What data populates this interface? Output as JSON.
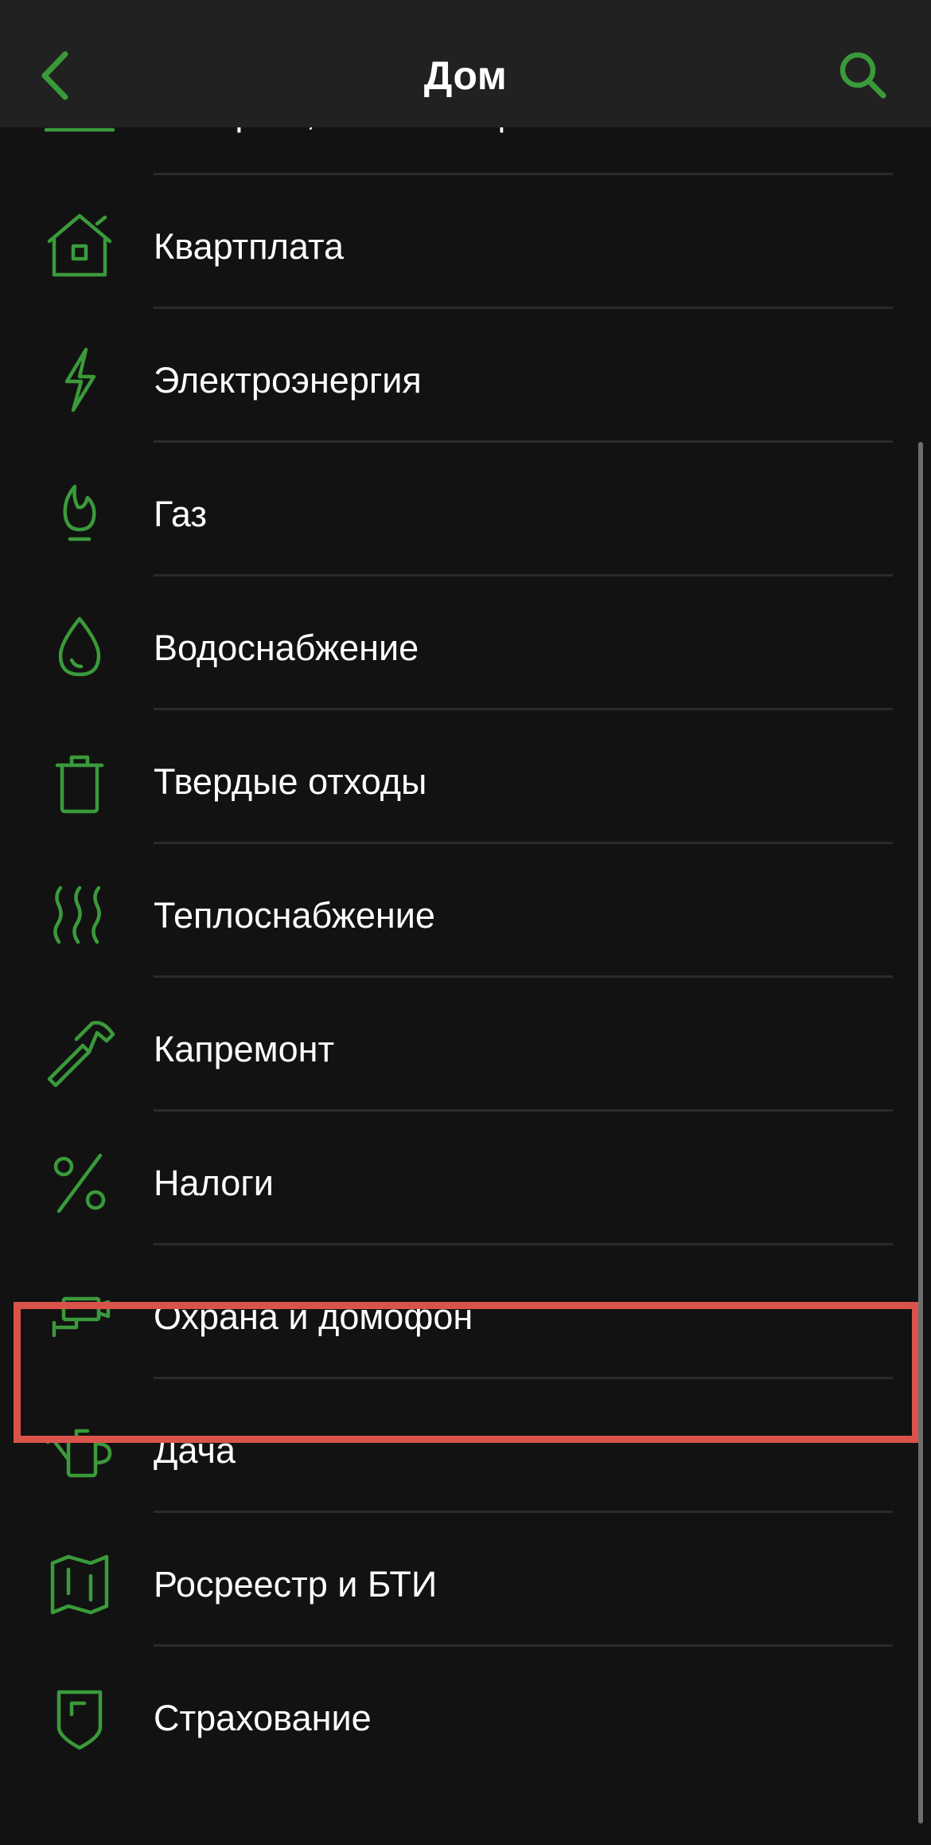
{
  "header": {
    "title": "Дом",
    "back_icon": "chevron-left-icon",
    "search_icon": "search-icon"
  },
  "colors": {
    "background": "#121212",
    "header_background": "#212121",
    "accent": "#3a9a3a",
    "highlight": "#d9534a",
    "divider": "#2b2b2b"
  },
  "items": [
    {
      "label": "Интернет, ТВ и телефония",
      "icon": "laptop-wifi-icon"
    },
    {
      "label": "Квартплата",
      "icon": "house-icon"
    },
    {
      "label": "Электроэнергия",
      "icon": "lightning-icon"
    },
    {
      "label": "Газ",
      "icon": "gas-flame-icon"
    },
    {
      "label": "Водоснабжение",
      "icon": "water-drop-icon"
    },
    {
      "label": "Твердые отходы",
      "icon": "trash-can-icon"
    },
    {
      "label": "Теплоснабжение",
      "icon": "heat-waves-icon"
    },
    {
      "label": "Капремонт",
      "icon": "hammer-icon"
    },
    {
      "label": "Налоги",
      "icon": "percent-icon"
    },
    {
      "label": "Охрана и домофон",
      "icon": "security-camera-icon",
      "highlighted": true
    },
    {
      "label": "Дача",
      "icon": "watering-can-icon"
    },
    {
      "label": "Росреестр и БТИ",
      "icon": "map-icon"
    },
    {
      "label": "Страхование",
      "icon": "shield-icon"
    }
  ]
}
